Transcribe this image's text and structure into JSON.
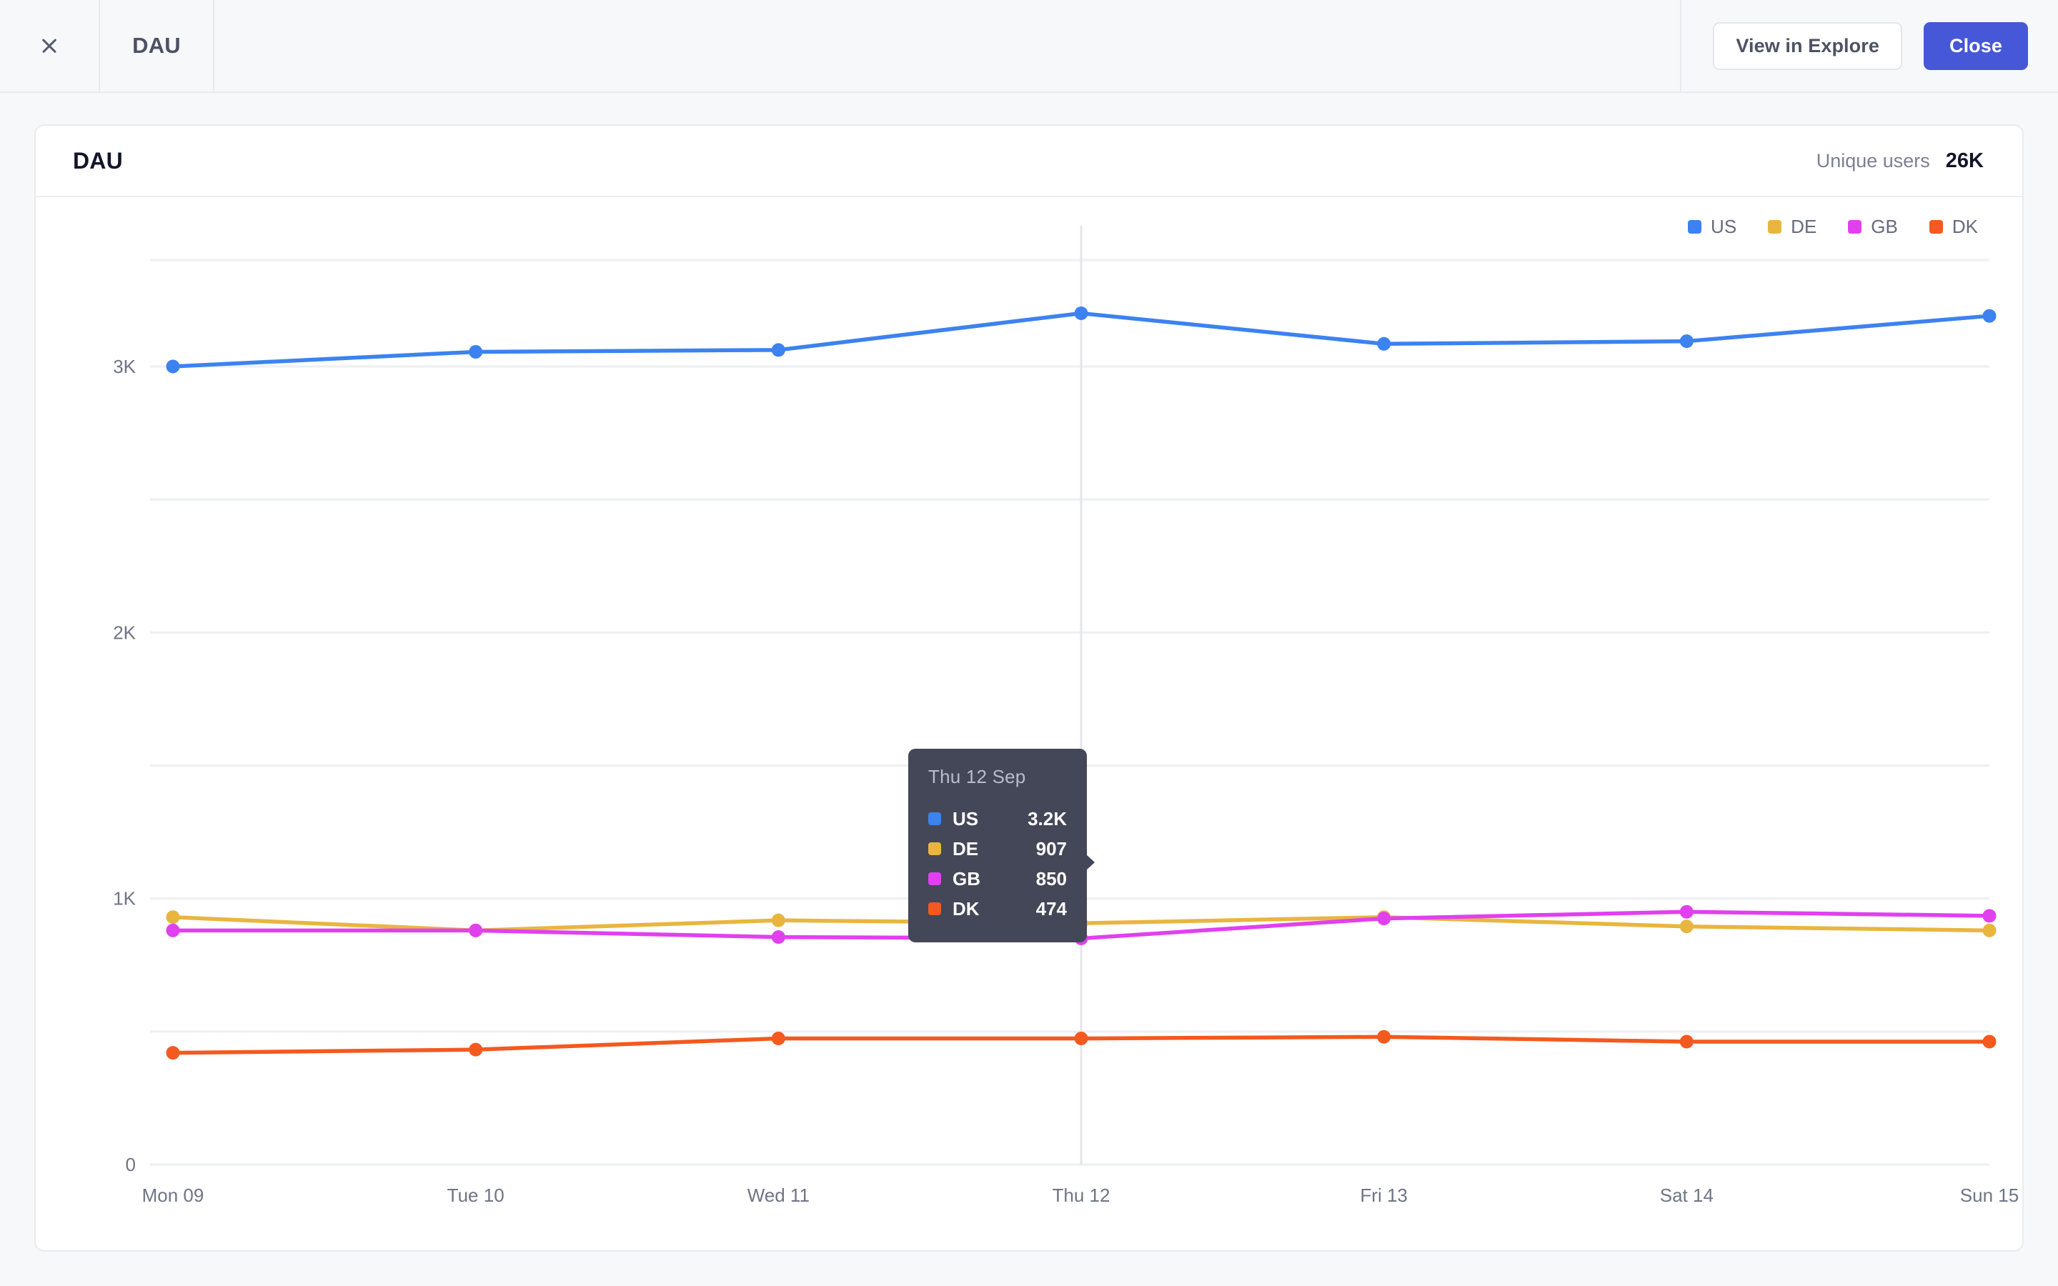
{
  "topbar": {
    "close_icon": "close-icon",
    "tab_label": "DAU",
    "view_in_explore_label": "View in Explore",
    "close_label": "Close"
  },
  "card": {
    "title": "DAU",
    "kpi_label": "Unique users",
    "kpi_value": "26K"
  },
  "colors": {
    "US": "#3c82f0",
    "DE": "#e8b63f",
    "GB": "#e140ef",
    "DK": "#f4591f",
    "accent": "#4657d8",
    "tooltip_bg": "#434758",
    "grid": "#eeeff2"
  },
  "legend": {
    "items": [
      {
        "label": "US",
        "color": "#3c82f0"
      },
      {
        "label": "DE",
        "color": "#e8b63f"
      },
      {
        "label": "GB",
        "color": "#e140ef"
      },
      {
        "label": "DK",
        "color": "#f4591f"
      }
    ]
  },
  "tooltip": {
    "date": "Thu 12 Sep",
    "rows": [
      {
        "label": "US",
        "value": "3.2K",
        "color": "#3c82f0"
      },
      {
        "label": "DE",
        "value": "907",
        "color": "#e8b63f"
      },
      {
        "label": "GB",
        "value": "850",
        "color": "#e140ef"
      },
      {
        "label": "DK",
        "value": "474",
        "color": "#f4591f"
      }
    ]
  },
  "chart_data": {
    "type": "line",
    "title": "DAU",
    "xlabel": "",
    "ylabel": "",
    "grid": true,
    "legend_position": "top-right",
    "categories": [
      "Mon 09",
      "Tue 10",
      "Wed 11",
      "Thu 12",
      "Fri 13",
      "Sat 14",
      "Sun 15"
    ],
    "ylim": [
      0,
      3400
    ],
    "yticks": [
      0,
      1000,
      2000,
      3000
    ],
    "ytick_labels": [
      "0",
      "1K",
      "2K",
      "3K"
    ],
    "minor_gridlines": [
      500,
      1500,
      2500,
      3400
    ],
    "highlighted_category": "Thu 12",
    "series": [
      {
        "name": "US",
        "color": "#3c82f0",
        "values": [
          3000,
          3055,
          3062,
          3200,
          3085,
          3095,
          3190
        ]
      },
      {
        "name": "DE",
        "color": "#e8b63f",
        "values": [
          930,
          880,
          918,
          907,
          930,
          895,
          880
        ]
      },
      {
        "name": "GB",
        "color": "#e140ef",
        "values": [
          880,
          880,
          855,
          850,
          925,
          950,
          935
        ]
      },
      {
        "name": "DK",
        "color": "#f4591f",
        "values": [
          420,
          432,
          474,
          474,
          480,
          462,
          462
        ]
      }
    ]
  }
}
